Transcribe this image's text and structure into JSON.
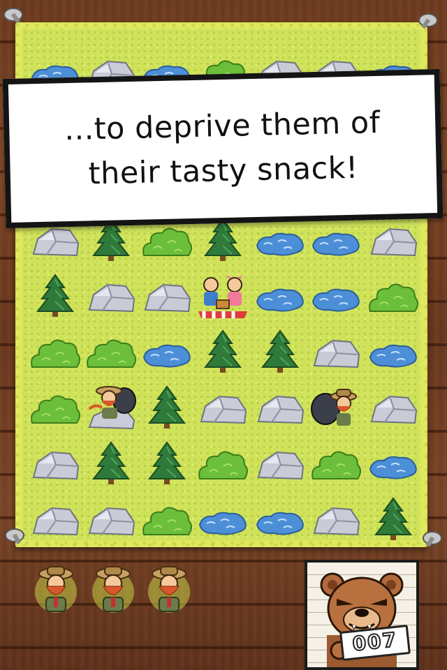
{
  "banner": {
    "text": "...to deprive them of\ntheir tasty snack!"
  },
  "board": {
    "columns": 7,
    "rows": [
      [
        "water",
        "rock",
        "water",
        "bush",
        "rock",
        "rock",
        "water"
      ],
      [
        "rock",
        "tree",
        "bush",
        "tree",
        "water",
        "water",
        "rock"
      ],
      [
        "tree",
        "rock",
        "rock",
        "picnic",
        "water",
        "water",
        "bush"
      ],
      [
        "bush",
        "bush",
        "water",
        "tree",
        "tree",
        "rock",
        "water"
      ],
      [
        "bush",
        "rock-ranger",
        "tree",
        "rock",
        "rock",
        "ranger",
        "rock"
      ],
      [
        "rock",
        "tree",
        "tree",
        "bush",
        "rock",
        "bush",
        "water"
      ],
      [
        "rock",
        "rock",
        "bush",
        "water",
        "water",
        "rock",
        "tree"
      ]
    ]
  },
  "lives": {
    "count": 3,
    "icon": "ranger-icon"
  },
  "mugshot": {
    "icon": "bear-mugshot",
    "number": "007"
  },
  "colors": {
    "wood": "#6e3b1f",
    "map": "#dfe85f",
    "banner_bg": "#ffffff",
    "banner_border": "#141414"
  }
}
